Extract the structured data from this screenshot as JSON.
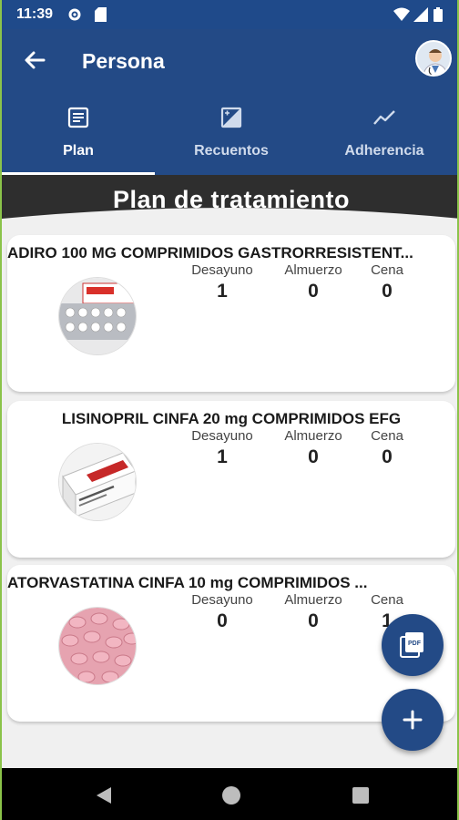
{
  "status_bar": {
    "time": "11:39",
    "icons": [
      "gear-icon",
      "sim-card-icon",
      "wifi-icon",
      "signal-icon",
      "battery-icon"
    ]
  },
  "app_bar": {
    "title": "Persona",
    "back_icon": "arrow-left-icon",
    "avatar_icon": "doctor-avatar"
  },
  "tabs": [
    {
      "label": "Plan",
      "icon": "document-icon",
      "active": true
    },
    {
      "label": "Recuentos",
      "icon": "image-icon",
      "active": false
    },
    {
      "label": "Adherencia",
      "icon": "trend-icon",
      "active": false
    }
  ],
  "section_title": "Plan de tratamiento",
  "dose_headers": {
    "breakfast": "Desayuno",
    "lunch": "Almuerzo",
    "dinner": "Cena"
  },
  "medications": [
    {
      "name": "ADIRO 100 MG COMPRIMIDOS GASTRORRESISTENT...",
      "breakfast": "1",
      "lunch": "0",
      "dinner": "0"
    },
    {
      "name": "LISINOPRIL CINFA 20 mg COMPRIMIDOS EFG",
      "breakfast": "1",
      "lunch": "0",
      "dinner": "0"
    },
    {
      "name": "ATORVASTATINA CINFA 10 mg COMPRIMIDOS ...",
      "breakfast": "0",
      "lunch": "0",
      "dinner": "1"
    }
  ],
  "fabs": [
    {
      "icon": "pdf-icon"
    },
    {
      "icon": "plus-icon"
    }
  ],
  "colors": {
    "primary": "#234a86",
    "status_bar": "#1f4a8a",
    "header_dark": "#2e2e2e",
    "background": "#f0f0f0"
  }
}
